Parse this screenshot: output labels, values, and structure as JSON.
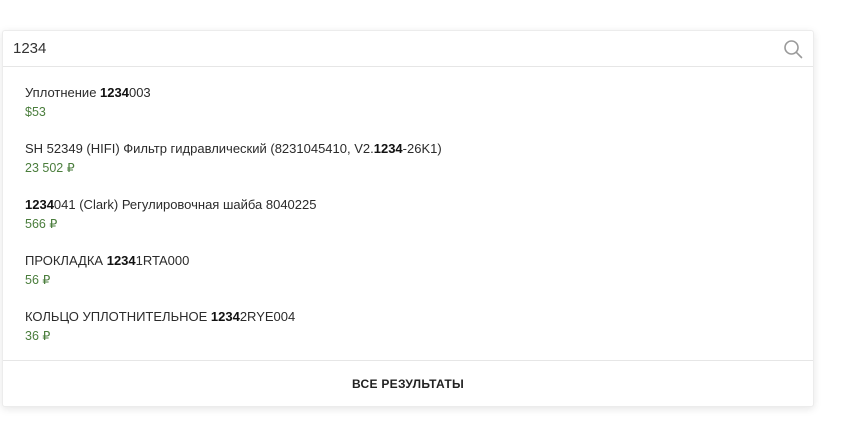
{
  "search": {
    "value": "1234",
    "icon": "search-icon"
  },
  "results": [
    {
      "pre": "Уплотнение ",
      "match": "1234",
      "post": "003",
      "price": "$53"
    },
    {
      "pre": "SH 52349 (HIFI) Фильтр гидравлический (8231045410, V2.",
      "match": "1234",
      "post": "-26K1)",
      "price": "23 502 ₽"
    },
    {
      "pre": "",
      "match": "1234",
      "post": "041 (Clark) Регулировочная шайба 8040225",
      "price": "566 ₽"
    },
    {
      "pre": "ПРОКЛАДКА ",
      "match": "1234",
      "post": "1RTA000",
      "price": "56 ₽"
    },
    {
      "pre": "КОЛЬЦО УПЛОТНИТЕЛЬНОЕ ",
      "match": "1234",
      "post": "2RYE004",
      "price": "36 ₽"
    }
  ],
  "footer": {
    "all_results_label": "ВСЕ РЕЗУЛЬТАТЫ"
  },
  "colors": {
    "price": "#4a7d3c",
    "text": "#2b2b2b",
    "border": "#e6e6e6"
  }
}
